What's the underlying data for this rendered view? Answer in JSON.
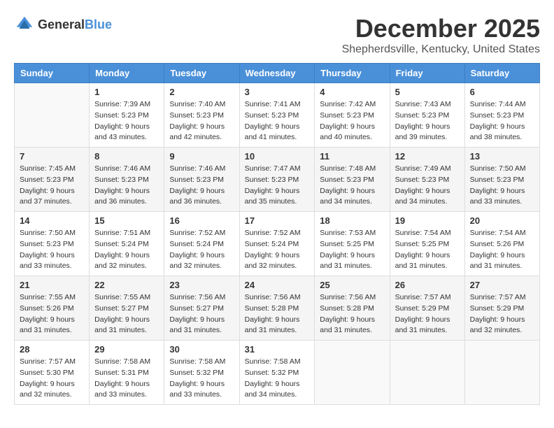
{
  "header": {
    "logo_general": "General",
    "logo_blue": "Blue",
    "month_title": "December 2025",
    "location": "Shepherdsville, Kentucky, United States"
  },
  "weekdays": [
    "Sunday",
    "Monday",
    "Tuesday",
    "Wednesday",
    "Thursday",
    "Friday",
    "Saturday"
  ],
  "weeks": [
    [
      {
        "day": "",
        "sunrise": "",
        "sunset": "",
        "daylight": ""
      },
      {
        "day": "1",
        "sunrise": "Sunrise: 7:39 AM",
        "sunset": "Sunset: 5:23 PM",
        "daylight": "Daylight: 9 hours and 43 minutes."
      },
      {
        "day": "2",
        "sunrise": "Sunrise: 7:40 AM",
        "sunset": "Sunset: 5:23 PM",
        "daylight": "Daylight: 9 hours and 42 minutes."
      },
      {
        "day": "3",
        "sunrise": "Sunrise: 7:41 AM",
        "sunset": "Sunset: 5:23 PM",
        "daylight": "Daylight: 9 hours and 41 minutes."
      },
      {
        "day": "4",
        "sunrise": "Sunrise: 7:42 AM",
        "sunset": "Sunset: 5:23 PM",
        "daylight": "Daylight: 9 hours and 40 minutes."
      },
      {
        "day": "5",
        "sunrise": "Sunrise: 7:43 AM",
        "sunset": "Sunset: 5:23 PM",
        "daylight": "Daylight: 9 hours and 39 minutes."
      },
      {
        "day": "6",
        "sunrise": "Sunrise: 7:44 AM",
        "sunset": "Sunset: 5:23 PM",
        "daylight": "Daylight: 9 hours and 38 minutes."
      }
    ],
    [
      {
        "day": "7",
        "sunrise": "Sunrise: 7:45 AM",
        "sunset": "Sunset: 5:23 PM",
        "daylight": "Daylight: 9 hours and 37 minutes."
      },
      {
        "day": "8",
        "sunrise": "Sunrise: 7:46 AM",
        "sunset": "Sunset: 5:23 PM",
        "daylight": "Daylight: 9 hours and 36 minutes."
      },
      {
        "day": "9",
        "sunrise": "Sunrise: 7:46 AM",
        "sunset": "Sunset: 5:23 PM",
        "daylight": "Daylight: 9 hours and 36 minutes."
      },
      {
        "day": "10",
        "sunrise": "Sunrise: 7:47 AM",
        "sunset": "Sunset: 5:23 PM",
        "daylight": "Daylight: 9 hours and 35 minutes."
      },
      {
        "day": "11",
        "sunrise": "Sunrise: 7:48 AM",
        "sunset": "Sunset: 5:23 PM",
        "daylight": "Daylight: 9 hours and 34 minutes."
      },
      {
        "day": "12",
        "sunrise": "Sunrise: 7:49 AM",
        "sunset": "Sunset: 5:23 PM",
        "daylight": "Daylight: 9 hours and 34 minutes."
      },
      {
        "day": "13",
        "sunrise": "Sunrise: 7:50 AM",
        "sunset": "Sunset: 5:23 PM",
        "daylight": "Daylight: 9 hours and 33 minutes."
      }
    ],
    [
      {
        "day": "14",
        "sunrise": "Sunrise: 7:50 AM",
        "sunset": "Sunset: 5:23 PM",
        "daylight": "Daylight: 9 hours and 33 minutes."
      },
      {
        "day": "15",
        "sunrise": "Sunrise: 7:51 AM",
        "sunset": "Sunset: 5:24 PM",
        "daylight": "Daylight: 9 hours and 32 minutes."
      },
      {
        "day": "16",
        "sunrise": "Sunrise: 7:52 AM",
        "sunset": "Sunset: 5:24 PM",
        "daylight": "Daylight: 9 hours and 32 minutes."
      },
      {
        "day": "17",
        "sunrise": "Sunrise: 7:52 AM",
        "sunset": "Sunset: 5:24 PM",
        "daylight": "Daylight: 9 hours and 32 minutes."
      },
      {
        "day": "18",
        "sunrise": "Sunrise: 7:53 AM",
        "sunset": "Sunset: 5:25 PM",
        "daylight": "Daylight: 9 hours and 31 minutes."
      },
      {
        "day": "19",
        "sunrise": "Sunrise: 7:54 AM",
        "sunset": "Sunset: 5:25 PM",
        "daylight": "Daylight: 9 hours and 31 minutes."
      },
      {
        "day": "20",
        "sunrise": "Sunrise: 7:54 AM",
        "sunset": "Sunset: 5:26 PM",
        "daylight": "Daylight: 9 hours and 31 minutes."
      }
    ],
    [
      {
        "day": "21",
        "sunrise": "Sunrise: 7:55 AM",
        "sunset": "Sunset: 5:26 PM",
        "daylight": "Daylight: 9 hours and 31 minutes."
      },
      {
        "day": "22",
        "sunrise": "Sunrise: 7:55 AM",
        "sunset": "Sunset: 5:27 PM",
        "daylight": "Daylight: 9 hours and 31 minutes."
      },
      {
        "day": "23",
        "sunrise": "Sunrise: 7:56 AM",
        "sunset": "Sunset: 5:27 PM",
        "daylight": "Daylight: 9 hours and 31 minutes."
      },
      {
        "day": "24",
        "sunrise": "Sunrise: 7:56 AM",
        "sunset": "Sunset: 5:28 PM",
        "daylight": "Daylight: 9 hours and 31 minutes."
      },
      {
        "day": "25",
        "sunrise": "Sunrise: 7:56 AM",
        "sunset": "Sunset: 5:28 PM",
        "daylight": "Daylight: 9 hours and 31 minutes."
      },
      {
        "day": "26",
        "sunrise": "Sunrise: 7:57 AM",
        "sunset": "Sunset: 5:29 PM",
        "daylight": "Daylight: 9 hours and 31 minutes."
      },
      {
        "day": "27",
        "sunrise": "Sunrise: 7:57 AM",
        "sunset": "Sunset: 5:29 PM",
        "daylight": "Daylight: 9 hours and 32 minutes."
      }
    ],
    [
      {
        "day": "28",
        "sunrise": "Sunrise: 7:57 AM",
        "sunset": "Sunset: 5:30 PM",
        "daylight": "Daylight: 9 hours and 32 minutes."
      },
      {
        "day": "29",
        "sunrise": "Sunrise: 7:58 AM",
        "sunset": "Sunset: 5:31 PM",
        "daylight": "Daylight: 9 hours and 33 minutes."
      },
      {
        "day": "30",
        "sunrise": "Sunrise: 7:58 AM",
        "sunset": "Sunset: 5:32 PM",
        "daylight": "Daylight: 9 hours and 33 minutes."
      },
      {
        "day": "31",
        "sunrise": "Sunrise: 7:58 AM",
        "sunset": "Sunset: 5:32 PM",
        "daylight": "Daylight: 9 hours and 34 minutes."
      },
      {
        "day": "",
        "sunrise": "",
        "sunset": "",
        "daylight": ""
      },
      {
        "day": "",
        "sunrise": "",
        "sunset": "",
        "daylight": ""
      },
      {
        "day": "",
        "sunrise": "",
        "sunset": "",
        "daylight": ""
      }
    ]
  ]
}
